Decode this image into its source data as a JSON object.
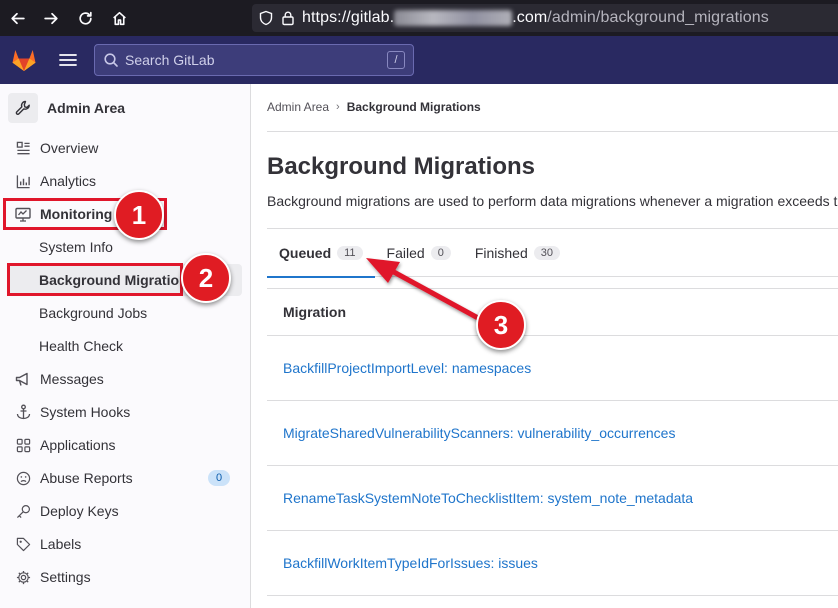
{
  "browser": {
    "url_prefix": "https://gitlab.",
    "url_suffix": ".com",
    "url_path": "/admin/background_migrations"
  },
  "header": {
    "search_placeholder": "Search GitLab",
    "search_shortcut": "/"
  },
  "sidebar": {
    "title": "Admin Area",
    "items": [
      {
        "label": "Overview",
        "icon": "overview-icon"
      },
      {
        "label": "Analytics",
        "icon": "chart-icon"
      },
      {
        "label": "Monitoring",
        "icon": "monitor-icon"
      },
      {
        "label": "System Info"
      },
      {
        "label": "Background Migrations"
      },
      {
        "label": "Background Jobs"
      },
      {
        "label": "Health Check"
      },
      {
        "label": "Messages",
        "icon": "bullhorn-icon"
      },
      {
        "label": "System Hooks",
        "icon": "anchor-icon"
      },
      {
        "label": "Applications",
        "icon": "applications-icon"
      },
      {
        "label": "Abuse Reports",
        "icon": "slight-frown-icon",
        "badge": "0"
      },
      {
        "label": "Deploy Keys",
        "icon": "key-icon"
      },
      {
        "label": "Labels",
        "icon": "label-icon"
      },
      {
        "label": "Settings",
        "icon": "gear-icon"
      }
    ]
  },
  "main": {
    "breadcrumb": {
      "root": "Admin Area",
      "current": "Background Migrations"
    },
    "title": "Background Migrations",
    "description": "Background migrations are used to perform data migrations whenever a migration exceeds t",
    "tabs": [
      {
        "label": "Queued",
        "count": "11"
      },
      {
        "label": "Failed",
        "count": "0"
      },
      {
        "label": "Finished",
        "count": "30"
      }
    ],
    "table": {
      "header": "Migration",
      "rows": [
        "BackfillProjectImportLevel: namespaces",
        "MigrateSharedVulnerabilityScanners: vulnerability_occurrences",
        "RenameTaskSystemNoteToChecklistItem: system_note_metadata",
        "BackfillWorkItemTypeIdForIssues: issues"
      ]
    }
  },
  "annotations": {
    "markers": [
      "1",
      "2",
      "3"
    ],
    "color": "#e0162b"
  }
}
